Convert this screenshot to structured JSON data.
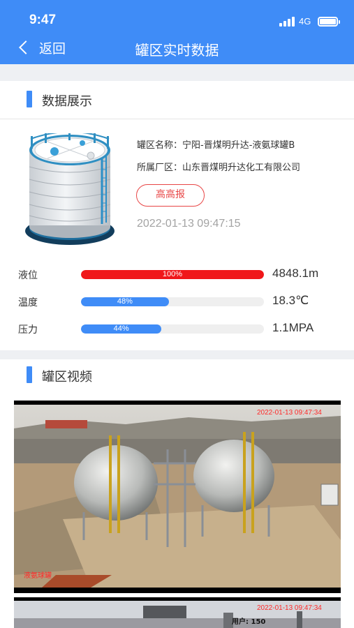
{
  "status": {
    "time": "9:47",
    "network": "4G"
  },
  "nav": {
    "back_label": "返回",
    "title": "罐区实时数据"
  },
  "data_section": {
    "title": "数据展示",
    "tank_name": "罐区名称：宁阳-晋煤明升达-液氨球罐B",
    "plant_area": "所属厂区：山东晋煤明升达化工有限公司",
    "alarm_label": "高高报",
    "timestamp": "2022-01-13 09:47:15",
    "metrics": [
      {
        "label": "液位",
        "percent": 100,
        "percent_text": "100%",
        "value": "4848.1m",
        "color": "#f0171a"
      },
      {
        "label": "温度",
        "percent": 48,
        "percent_text": "48%",
        "value": "18.3℃",
        "color": "#3f8cf7"
      },
      {
        "label": "压力",
        "percent": 44,
        "percent_text": "44%",
        "value": "1.1MPA",
        "color": "#3f8cf7"
      }
    ]
  },
  "video_section": {
    "title": "罐区视频",
    "videos": [
      {
        "timestamp": "2022-01-13 09:47:34",
        "caption": "液氨球罐"
      },
      {
        "timestamp": "2022-01-13 09:47:34",
        "user_label": "用户: 150"
      }
    ]
  },
  "colors": {
    "accent": "#3f8cf7",
    "alarm": "#e84545",
    "danger_bar": "#f0171a"
  }
}
